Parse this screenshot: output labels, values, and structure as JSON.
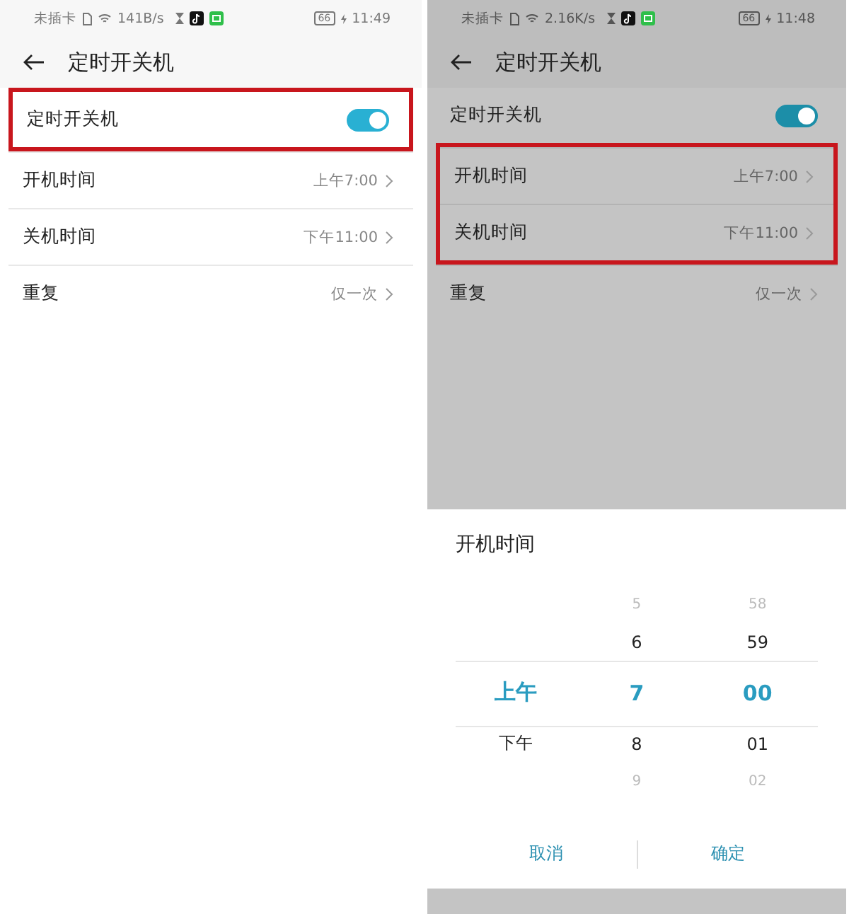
{
  "screens": [
    {
      "dimmed": false,
      "status_bar": {
        "carrier": "未插卡",
        "speed": "141B/s",
        "battery": "66",
        "time": "11:49"
      },
      "title": "定时开关机",
      "rows": [
        {
          "kind": "toggle",
          "label": "定时开关机",
          "on": true,
          "highlighted": true
        },
        {
          "kind": "link",
          "label": "开机时间",
          "value": "上午7:00",
          "highlighted": false
        },
        {
          "kind": "link",
          "label": "关机时间",
          "value": "下午11:00",
          "highlighted": false
        },
        {
          "kind": "link",
          "label": "重复",
          "value": "仅一次",
          "highlighted": false
        }
      ]
    },
    {
      "dimmed": true,
      "status_bar": {
        "carrier": "未插卡",
        "speed": "2.16K/s",
        "battery": "66",
        "time": "11:48"
      },
      "title": "定时开关机",
      "rows": [
        {
          "kind": "toggle",
          "label": "定时开关机",
          "on": true,
          "highlighted": false
        },
        {
          "kind": "link",
          "label": "开机时间",
          "value": "上午7:00",
          "highlighted": true
        },
        {
          "kind": "link",
          "label": "关机时间",
          "value": "下午11:00",
          "highlighted": true
        },
        {
          "kind": "link",
          "label": "重复",
          "value": "仅一次",
          "highlighted": false
        }
      ],
      "picker": {
        "title": "开机时间",
        "columns": [
          {
            "items": [
              {
                "text": "上午",
                "selected": true
              },
              {
                "text": "下午",
                "selected": false
              }
            ]
          },
          {
            "items": [
              {
                "text": "5",
                "selected": false
              },
              {
                "text": "6",
                "selected": false
              },
              {
                "text": "7",
                "selected": true
              },
              {
                "text": "8",
                "selected": false
              },
              {
                "text": "9",
                "selected": false
              }
            ]
          },
          {
            "items": [
              {
                "text": "58",
                "selected": false
              },
              {
                "text": "59",
                "selected": false
              },
              {
                "text": "00",
                "selected": true
              },
              {
                "text": "01",
                "selected": false
              },
              {
                "text": "02",
                "selected": false
              }
            ]
          }
        ],
        "buttons": [
          "取消",
          "确定"
        ]
      }
    }
  ]
}
